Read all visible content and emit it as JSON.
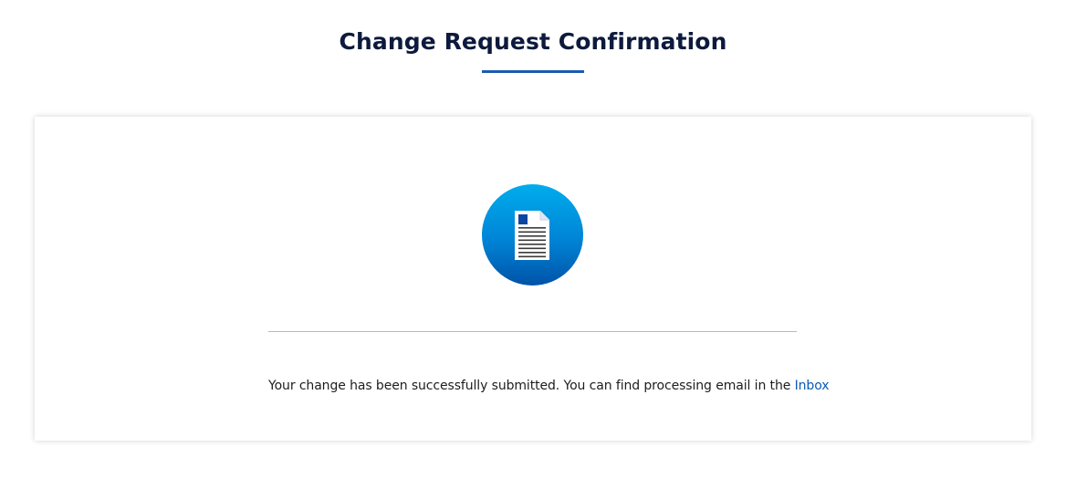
{
  "header": {
    "title": "Change Request Confirmation"
  },
  "confirmation": {
    "icon": "document-icon",
    "message": "Your change has been successfully submitted. You can find processing email in the",
    "link_label": "Inbox"
  },
  "colors": {
    "title": "#0d1a3d",
    "accent": "#1a5bb0",
    "link": "#0a5bb5",
    "icon_gradient_top": "#00acec",
    "icon_gradient_bottom": "#0053a8"
  }
}
